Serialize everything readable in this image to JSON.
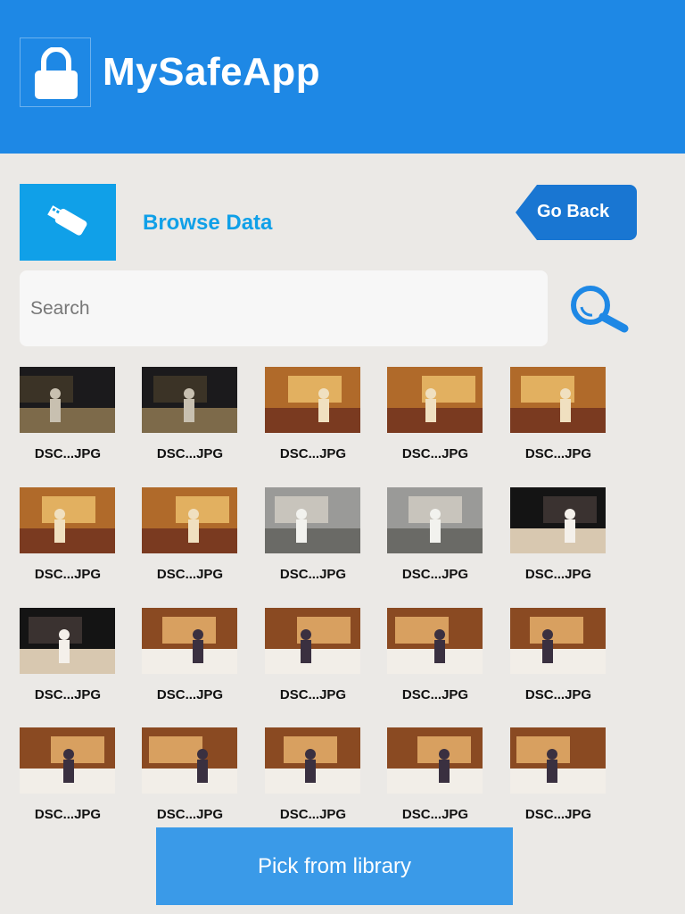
{
  "header": {
    "title": "MySafeApp",
    "logo_icon": "lock-icon"
  },
  "toolbar": {
    "browse_icon": "usb-drive-icon",
    "browse_label": "Browse Data",
    "back_label": "Go Back"
  },
  "search": {
    "placeholder": "Search",
    "value": "",
    "icon": "magnifier-icon"
  },
  "files": [
    {
      "name": "DSC...JPG",
      "scene": "night"
    },
    {
      "name": "DSC...JPG",
      "scene": "night"
    },
    {
      "name": "DSC...JPG",
      "scene": "lobby"
    },
    {
      "name": "DSC...JPG",
      "scene": "lobby"
    },
    {
      "name": "DSC...JPG",
      "scene": "lobby"
    },
    {
      "name": "DSC...JPG",
      "scene": "lobby"
    },
    {
      "name": "DSC...JPG",
      "scene": "lobby"
    },
    {
      "name": "DSC...JPG",
      "scene": "street"
    },
    {
      "name": "DSC...JPG",
      "scene": "street"
    },
    {
      "name": "DSC...JPG",
      "scene": "dark"
    },
    {
      "name": "DSC...JPG",
      "scene": "dark"
    },
    {
      "name": "DSC...JPG",
      "scene": "dinner"
    },
    {
      "name": "DSC...JPG",
      "scene": "dinner"
    },
    {
      "name": "DSC...JPG",
      "scene": "dinner"
    },
    {
      "name": "DSC...JPG",
      "scene": "dinner"
    },
    {
      "name": "DSC...JPG",
      "scene": "dinner"
    },
    {
      "name": "DSC...JPG",
      "scene": "dinner"
    },
    {
      "name": "DSC...JPG",
      "scene": "dinner"
    },
    {
      "name": "DSC...JPG",
      "scene": "dinner"
    },
    {
      "name": "DSC...JPG",
      "scene": "dinner"
    }
  ],
  "footer": {
    "pick_label": "Pick from library"
  },
  "colors": {
    "header": "#1e88e5",
    "accent": "#10a0e8",
    "button": "#3a9ae8",
    "background": "#ebe9e6"
  }
}
